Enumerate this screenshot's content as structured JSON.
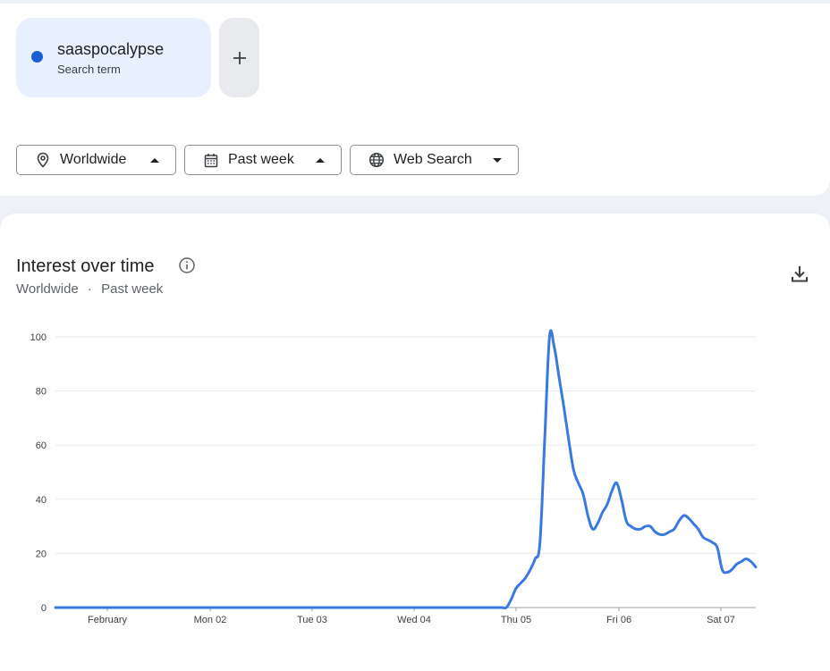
{
  "search_term": {
    "name": "saaspocalypse",
    "subtitle": "Search term",
    "color": "#1a5ed7",
    "add_icon": "plus-icon"
  },
  "filters": [
    {
      "label": "Worldwide",
      "icon": "location-pin-icon",
      "caret": "up"
    },
    {
      "label": "Past week",
      "icon": "calendar-icon",
      "caret": "up"
    },
    {
      "label": "Web Search",
      "icon": "globe-icon",
      "caret": "down"
    }
  ],
  "panel": {
    "title": "Interest over time",
    "subtitle_region": "Worldwide",
    "subtitle_sep": "·",
    "subtitle_period": "Past week",
    "info_icon": "info-icon",
    "download_icon": "download-icon"
  },
  "chart_data": {
    "type": "line",
    "ylim": [
      0,
      100
    ],
    "y_ticks": [
      0,
      20,
      40,
      60,
      80,
      100
    ],
    "x_ticks": [
      "February",
      "Mon 02",
      "Tue 03",
      "Wed 04",
      "Thu 05",
      "Fri 06",
      "Sat 07"
    ],
    "grid": true,
    "line_color": "#3a79e0",
    "series": [
      {
        "values": [
          0,
          0,
          0,
          0,
          0,
          0,
          0,
          0,
          0,
          0,
          0,
          0,
          0,
          0,
          0,
          0,
          0,
          0,
          0,
          0,
          0,
          0,
          0,
          0,
          0,
          0,
          0,
          0,
          0,
          0,
          0,
          0,
          0,
          0,
          0,
          0,
          0,
          0,
          0,
          0,
          0,
          0,
          0,
          0,
          0,
          0,
          0,
          0,
          0,
          0,
          0,
          0,
          0,
          0,
          0,
          0,
          0,
          0,
          0,
          0,
          0,
          0,
          0,
          0,
          0,
          0,
          0,
          0,
          0,
          0,
          0,
          0,
          0,
          0,
          0,
          0,
          0,
          0,
          0,
          0,
          0,
          0,
          0,
          0,
          0,
          0,
          0,
          0,
          0,
          0,
          0,
          0,
          0,
          0,
          0,
          3,
          7,
          9,
          11,
          14,
          18,
          24,
          62,
          100,
          96,
          85,
          74,
          62,
          51,
          46,
          42,
          34,
          29,
          31,
          35,
          38,
          43,
          46,
          40,
          32,
          30,
          29,
          29,
          30,
          30,
          28,
          27,
          27,
          28,
          29,
          32,
          34,
          33,
          31,
          29,
          26,
          25,
          24,
          22,
          14,
          13,
          14,
          16,
          17,
          18,
          17,
          15
        ]
      }
    ]
  }
}
